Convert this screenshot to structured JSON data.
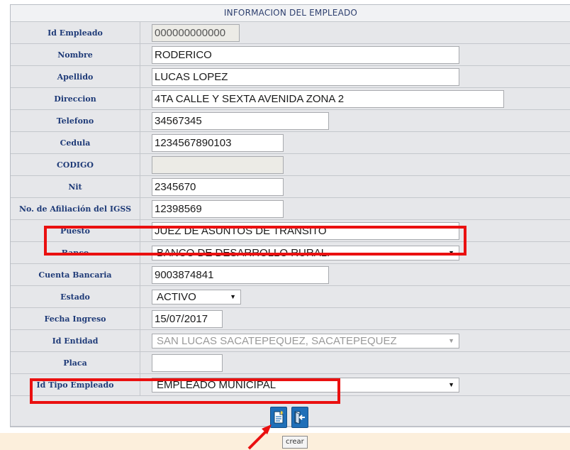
{
  "form": {
    "title": "INFORMACION DEL EMPLEADO",
    "fields": {
      "id_empleado": {
        "label": "Id Empleado",
        "value": "000000000000"
      },
      "nombre": {
        "label": "Nombre",
        "value": "RODERICO"
      },
      "apellido": {
        "label": "Apellido",
        "value": "LUCAS LOPEZ"
      },
      "direccion": {
        "label": "Direccion",
        "value": "4TA CALLE Y SEXTA AVENIDA ZONA 2"
      },
      "telefono": {
        "label": "Telefono",
        "value": "34567345"
      },
      "cedula": {
        "label": "Cedula",
        "value": "1234567890103"
      },
      "codigo": {
        "label": "CODIGO",
        "value": ""
      },
      "nit": {
        "label": "Nit",
        "value": "2345670"
      },
      "igss": {
        "label": "No. de Afiliación del IGSS",
        "value": "12398569"
      },
      "puesto": {
        "label": "Puesto",
        "value": "JUEZ DE ASUNTOS DE TRANSITO"
      },
      "banco": {
        "label": "Banco",
        "value": "BANCO DE DESARROLLO RURAL."
      },
      "cuenta": {
        "label": "Cuenta Bancaria",
        "value": "9003874841"
      },
      "estado": {
        "label": "Estado",
        "value": "ACTIVO"
      },
      "fecha_ingreso": {
        "label": "Fecha Ingreso",
        "value": "15/07/2017"
      },
      "id_entidad": {
        "label": "Id Entidad",
        "value": "SAN LUCAS SACATEPEQUEZ, SACATEPEQUEZ"
      },
      "placa": {
        "label": "Placa",
        "value": ""
      },
      "id_tipo_empleado": {
        "label": "Id Tipo Empleado",
        "value": "EMPLEADO MUNICIPAL"
      }
    }
  },
  "buttons": {
    "create": {
      "icon": "new-document-icon"
    },
    "exit": {
      "icon": "exit-door-icon"
    },
    "tooltip": "crear"
  },
  "colors": {
    "label_text": "#1f3b78",
    "highlight": "#ea1010",
    "button_blue": "#1f6fb8"
  }
}
